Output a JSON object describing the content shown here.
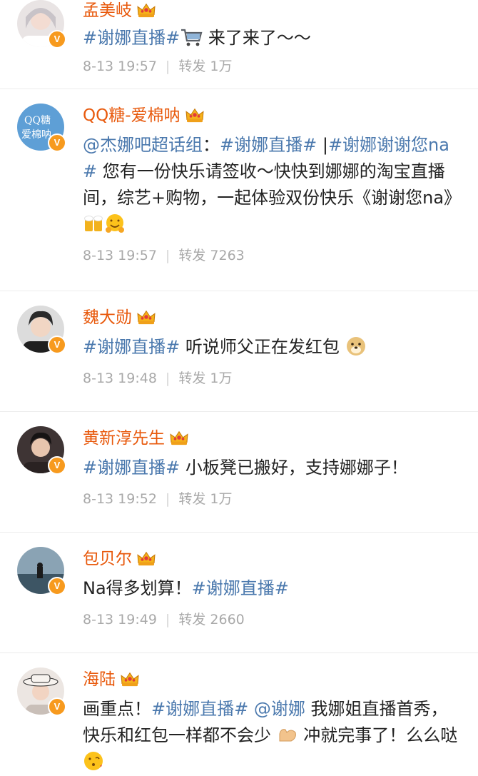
{
  "colors": {
    "name": "#e8590c",
    "topic": "#4a78ad",
    "meta": "#a9a9a9",
    "badge": "#f79a1e"
  },
  "icons": {
    "verified": "verified-v-badge",
    "crown": "crown-icon",
    "cart": "shopping-cart-emoji"
  },
  "posts": [
    {
      "name": "孟美岐",
      "seg": [
        "#谢娜直播#",
        " 来了来了～～"
      ],
      "time": "8-13 19:57",
      "repost_label": "转发",
      "reposts": "1万"
    },
    {
      "name": "QQ糖-爱棉呐",
      "avatar_text": [
        "QQ糖",
        "爱棉呐"
      ],
      "seg": [
        "@杰娜吧超话组",
        "：",
        "#谢娜直播#",
        " |",
        "#谢娜谢谢您na#",
        " 您有一份快乐请签收～快快到娜娜的淘宝直播间，综艺+购物，一起体验双份快乐《谢谢您na》"
      ],
      "time": "8-13 19:57",
      "repost_label": "转发",
      "reposts": "7263"
    },
    {
      "name": "魏大勋",
      "seg": [
        "#谢娜直播#",
        " 听说师父正在发红包"
      ],
      "time": "8-13 19:48",
      "repost_label": "转发",
      "reposts": "1万"
    },
    {
      "name": "黄新淳先生",
      "seg": [
        "#谢娜直播#",
        " 小板凳已搬好，支持娜娜子！"
      ],
      "time": "8-13 19:52",
      "repost_label": "转发",
      "reposts": "1万"
    },
    {
      "name": "包贝尔",
      "seg": [
        "Na得多划算！",
        "#谢娜直播#"
      ],
      "time": "8-13 19:49",
      "repost_label": "转发",
      "reposts": "2660"
    },
    {
      "name": "海陆",
      "seg": [
        "画重点！",
        "#谢娜直播#",
        " ",
        "@谢娜",
        " 我娜姐直播首秀，快乐和红包一样都不会少",
        " 冲就完事了！么么哒"
      ]
    }
  ]
}
